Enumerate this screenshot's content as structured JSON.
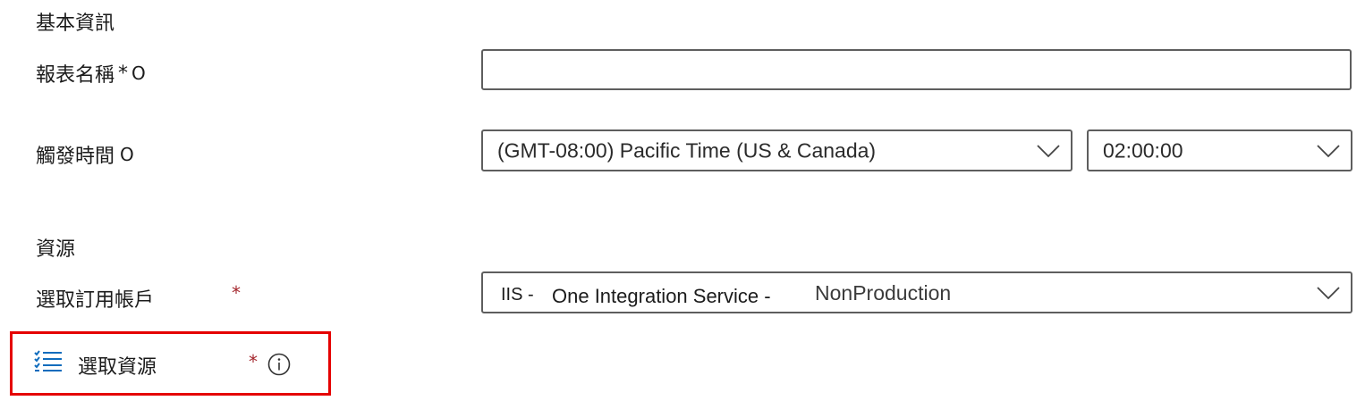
{
  "basic_info": {
    "heading": "基本資訊",
    "report_name": {
      "label": "報表名稱",
      "required_mark": "*",
      "info_mark": "O",
      "value": ""
    },
    "trigger_time": {
      "label": "觸發時間",
      "info_mark": "O",
      "timezone_value": "(GMT-08:00) Pacific Time (US & Canada)",
      "time_value": "02:00:00"
    }
  },
  "resources": {
    "heading": "資源",
    "subscription": {
      "label": "選取訂用帳戶",
      "required_mark": "*",
      "value_prefix": "IIS -",
      "value_name": "One Integration Service -",
      "value_suffix": "NonProduction"
    },
    "select_resources": {
      "label": "選取資源",
      "required_mark": "*",
      "icon": "checklist-icon",
      "info_icon": "info-icon"
    }
  },
  "colors": {
    "required": "#a4262c",
    "highlight": "#e50000",
    "icon_blue": "#0f6cbd",
    "border": "#5e5e5e"
  }
}
